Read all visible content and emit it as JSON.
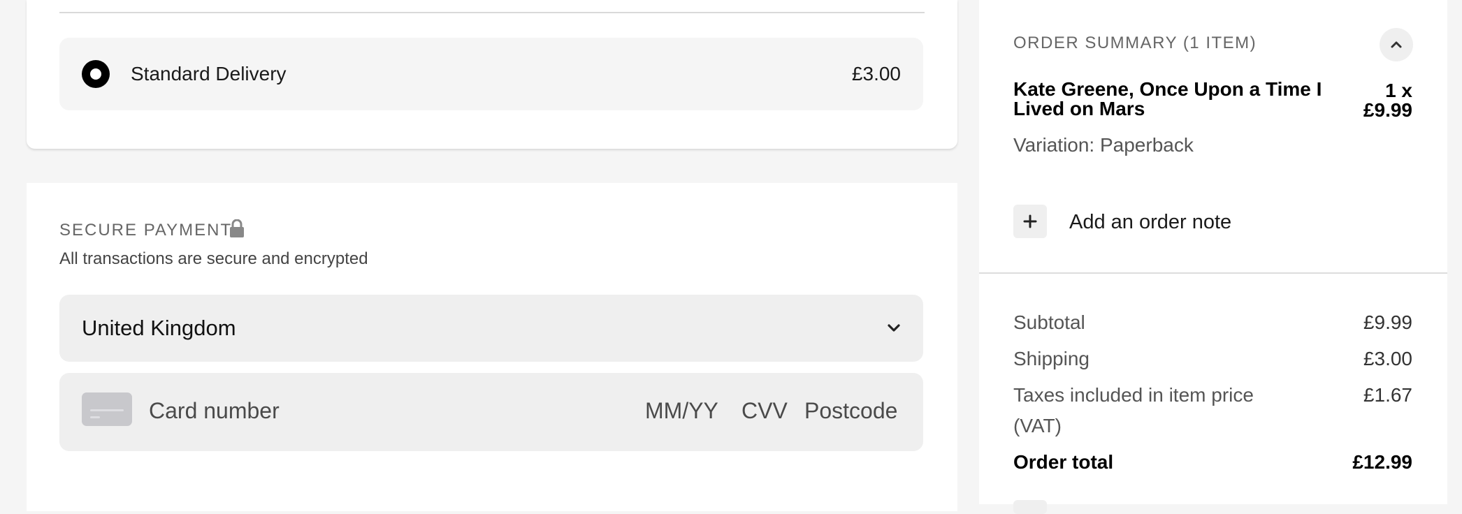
{
  "shipping": {
    "option_label": "Standard Delivery",
    "option_price": "£3.00"
  },
  "payment": {
    "title": "SECURE PAYMENT",
    "subtitle": "All transactions are secure and encrypted",
    "country": "United Kingdom",
    "card_number_placeholder": "Card number",
    "expiry_placeholder": "MM/YY",
    "cvv_placeholder": "CVV",
    "postcode_placeholder": "Postcode",
    "icons": {
      "lock": "lock-icon",
      "card": "card-icon",
      "dropdown": "chevron-down-icon"
    }
  },
  "summary": {
    "title": "ORDER SUMMARY (1 ITEM)",
    "item": {
      "name": "Kate Greene, Once Upon a Time I Lived on Mars",
      "quantity": "1 x",
      "price": "£9.99",
      "variation": "Variation: Paperback"
    },
    "add_note_label": "Add an order note",
    "rows": {
      "subtotal_label": "Subtotal",
      "subtotal_value": "£9.99",
      "shipping_label": "Shipping",
      "shipping_value": "£3.00",
      "taxes_label": "Taxes included in item price (VAT)",
      "taxes_value": "£1.67",
      "total_label": "Order total",
      "total_value": "£12.99"
    },
    "icons": {
      "collapse": "chevron-up-icon",
      "add": "plus-icon"
    }
  },
  "colors": {
    "page_bg": "#f5f5f5",
    "field_bg": "#efefef",
    "radio_selected": "#000000"
  }
}
